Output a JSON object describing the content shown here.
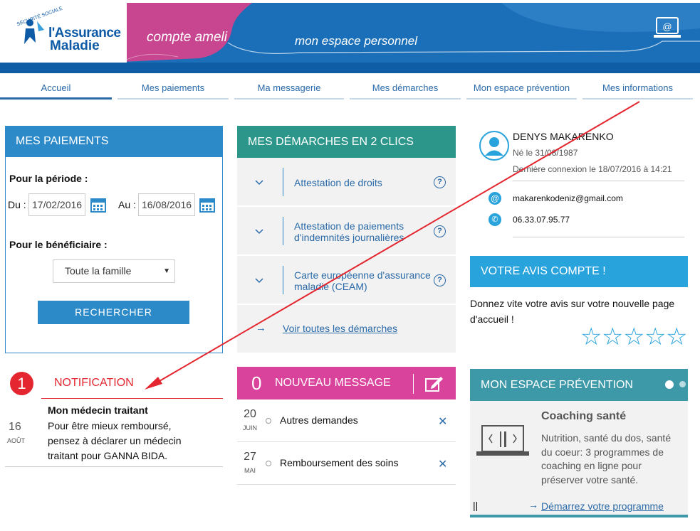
{
  "header": {
    "logo_line1": "l'Assurance",
    "logo_line2": "Maladie",
    "logo_secu": "SÉCURITÉ SOCIALE",
    "compte": "compte ameli",
    "espace": "mon espace personnel",
    "laptop_icon": "laptop-at-icon"
  },
  "nav": [
    "Accueil",
    "Mes paiements",
    "Ma messagerie",
    "Mes démarches",
    "Mon espace prévention",
    "Mes informations"
  ],
  "paiements": {
    "title": "MES PAIEMENTS",
    "periode": "Pour la période :",
    "du": "Du :",
    "du_value": "17/02/2016",
    "au": "Au :",
    "au_value": "16/08/2016",
    "beneficiaire": "Pour le bénéficiaire :",
    "select_value": "Toute la famille",
    "button": "RECHERCHER"
  },
  "notification": {
    "count": "1",
    "title": "NOTIFICATION",
    "day": "16",
    "month": "AOÛT",
    "heading": "Mon médecin traitant",
    "body": "Pour être mieux remboursé, pensez à déclarer un médecin traitant pour GANNA BIDA."
  },
  "demarches": {
    "title": "MES DÉMARCHES EN 2 CLICS",
    "items": [
      "Attestation de droits",
      "Attestation de paiements d'indemnités journalières",
      "Carte européenne d'assurance maladie (CEAM)"
    ],
    "voir": "Voir toutes les démarches"
  },
  "messages": {
    "count": "0",
    "title": "NOUVEAU MESSAGE",
    "items": [
      {
        "day": "20",
        "month": "JUIN",
        "label": "Autres demandes"
      },
      {
        "day": "27",
        "month": "MAI",
        "label": "Remboursement des soins"
      }
    ]
  },
  "profile": {
    "name": "DENYS MAKARENKO",
    "birth": "Né le 31/08/1987",
    "last_login": "Dernière connexion le 18/07/2016 à 14:21",
    "email": "makarenkodeniz@gmail.com",
    "phone": "06.33.07.95.77"
  },
  "avis": {
    "title": "VOTRE AVIS COMPTE  !",
    "text": "Donnez vite votre avis sur votre nouvelle page d'accueil !",
    "stars": 5
  },
  "prevention": {
    "title": "MON ESPACE PRÉVENTION",
    "heading": "Coaching santé",
    "text": "Nutrition, santé du dos, santé du coeur: 3 programmes de coaching en ligne pour préserver votre santé.",
    "link": "Démarrez votre programme",
    "pause": "||"
  },
  "colors": {
    "blue": "#2d8ac8",
    "teal": "#2c968b",
    "pink": "#d9439c",
    "red": "#e3262f",
    "avis": "#29a3dc",
    "prev": "#3d98a8"
  }
}
